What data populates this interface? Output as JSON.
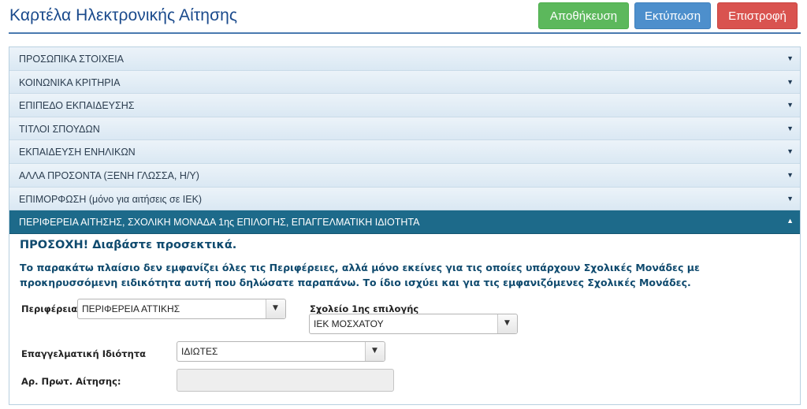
{
  "header": {
    "title": "Καρτέλα Ηλεκτρονικής Αίτησης",
    "buttons": {
      "save": "Αποθήκευση",
      "print": "Εκτύπωση",
      "back": "Επιστροφή"
    }
  },
  "accordion": {
    "sections": [
      {
        "label": "ΠΡΟΣΩΠΙΚΑ ΣΤΟΙΧΕΙΑ",
        "arrow": "▼"
      },
      {
        "label": "ΚΟΙΝΩΝΙΚΑ ΚΡΙΤΗΡΙΑ",
        "arrow": "▼"
      },
      {
        "label": "ΕΠΙΠΕΔΟ ΕΚΠΑΙΔΕΥΣΗΣ",
        "arrow": "▼"
      },
      {
        "label": "ΤΙΤΛΟΙ ΣΠΟΥΔΩΝ",
        "arrow": "▼"
      },
      {
        "label": "ΕΚΠΑΙΔΕΥΣΗ ΕΝΗΛΙΚΩΝ",
        "arrow": "▼"
      },
      {
        "label": "ΑΛΛΑ ΠΡΟΣΟΝΤΑ (ΞΕΝΗ ΓΛΩΣΣΑ, Η/Υ)",
        "arrow": "▼"
      },
      {
        "label": "ΕΠΙΜΟΡΦΩΣΗ (μόνο για αιτήσεις σε ΙΕΚ)",
        "arrow": "▼"
      },
      {
        "label": "ΠΕΡΙΦΕΡΕΙΑ ΑΙΤΗΣΗΣ, ΣΧΟΛΙΚΗ ΜΟΝΑΔΑ 1ης ΕΠΙΛΟΓΗΣ, ΕΠΑΓΓΕΛΜΑΤΙΚΗ ΙΔΙΟΤΗΤΑ",
        "arrow": "▲"
      }
    ]
  },
  "panel": {
    "warning_title": "ΠΡΟΣΟΧΗ! Διαβάστε προσεκτικά.",
    "warning_text": "Το παρακάτω πλαίσιο δεν εμφανίζει όλες τις Περιφέρειες, αλλά μόνο εκείνες για τις οποίες υπάρχουν Σχολικές Μονάδες με προκηρυσσόμενη ειδικότητα αυτή που δηλώσατε παραπάνω. Το ίδιο ισχύει και για τις εμφανιζόμενες Σχολικές Μονάδες.",
    "region": {
      "label": "Περιφέρεια",
      "value": "ΠΕΡΙΦΕΡΕΙΑ ΑΤΤΙΚΗΣ"
    },
    "school": {
      "label": "Σχολείο 1ης επιλογής",
      "value": "ΙΕΚ ΜΟΣΧΑΤΟΥ"
    },
    "occupation": {
      "label": "Επαγγελματική Ιδιότητα",
      "value": "ΙΔΙΩΤΕΣ"
    },
    "protocol": {
      "label": "Αρ. Πρωτ. Αίτησης:",
      "value": ""
    }
  }
}
